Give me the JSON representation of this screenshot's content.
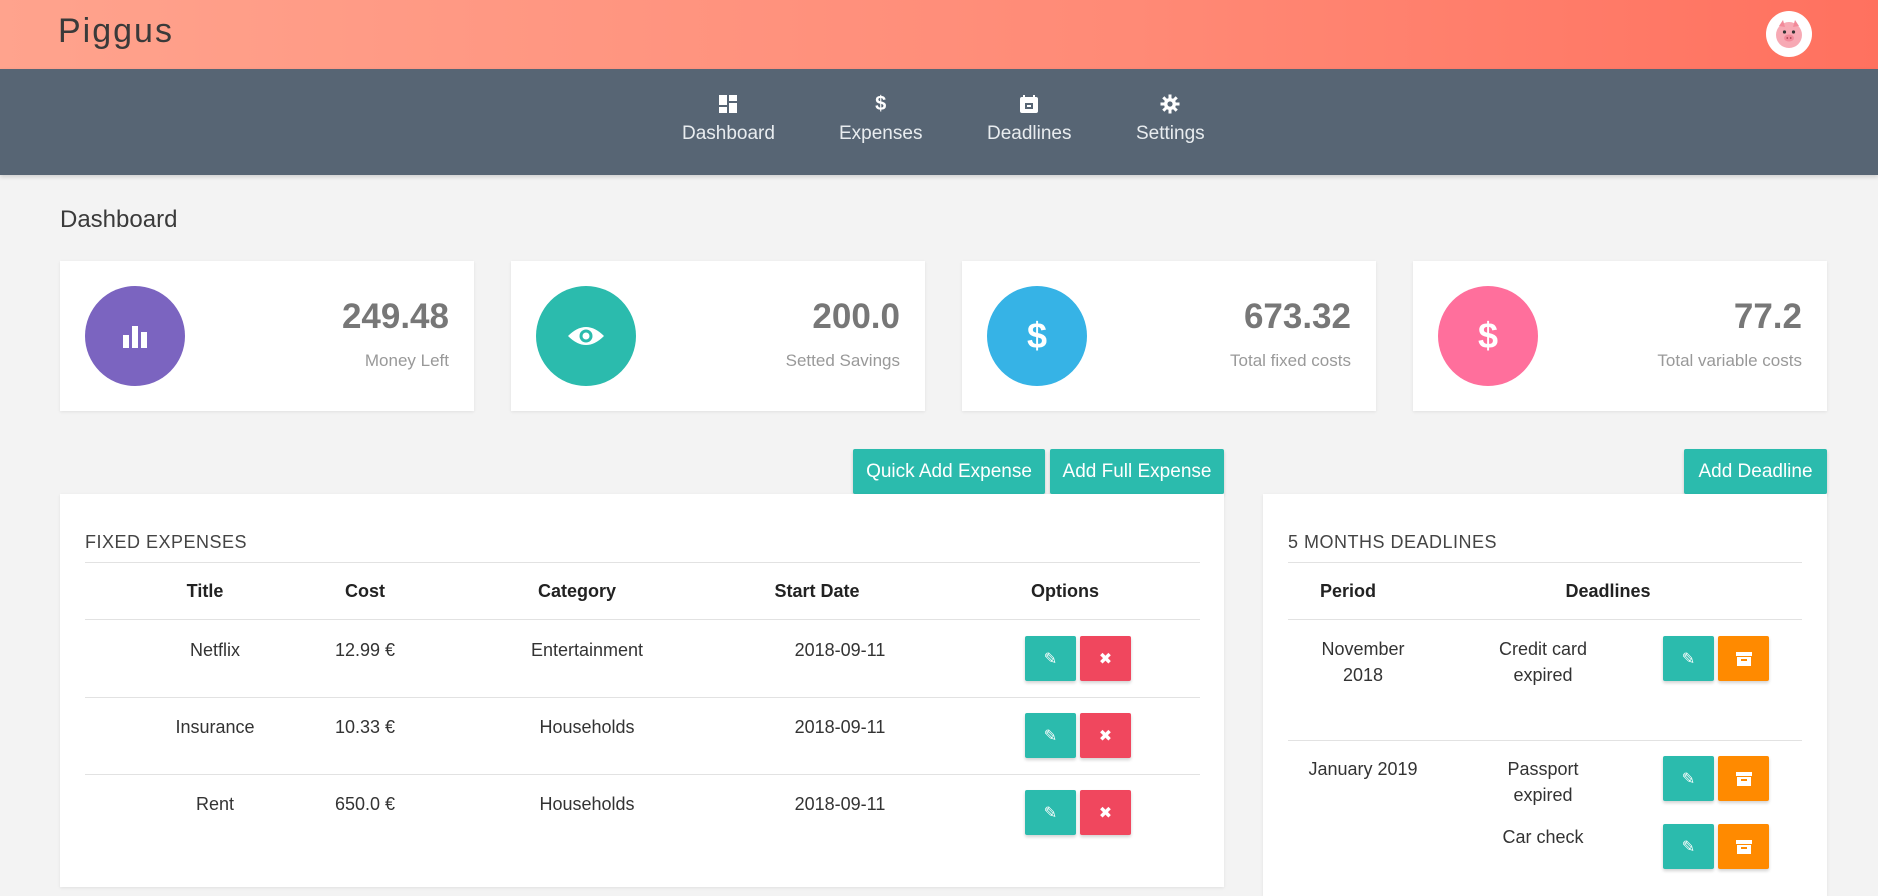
{
  "app": {
    "logo": "Piggus"
  },
  "nav": [
    {
      "label": "Dashboard",
      "icon": "dashboard-icon"
    },
    {
      "label": "Expenses",
      "icon": "dollar-icon"
    },
    {
      "label": "Deadlines",
      "icon": "calendar-icon"
    },
    {
      "label": "Settings",
      "icon": "gear-icon"
    }
  ],
  "page": {
    "title": "Dashboard"
  },
  "stats": [
    {
      "value": "249.48",
      "label": "Money Left",
      "color": "#7b64c0",
      "icon": "bar-chart-icon"
    },
    {
      "value": "200.0",
      "label": "Setted Savings",
      "color": "#2bbbad",
      "icon": "eye-icon"
    },
    {
      "value": "673.32",
      "label": "Total fixed costs",
      "color": "#36b3e6",
      "icon": "dollar-icon"
    },
    {
      "value": "77.2",
      "label": "Total variable costs",
      "color": "#ff6f9c",
      "icon": "dollar-icon"
    }
  ],
  "actions": {
    "quick_add": "Quick Add Expense",
    "full_add": "Add Full Expense",
    "add_deadline": "Add Deadline"
  },
  "fixed": {
    "title": "FIXED EXPENSES",
    "headers": [
      "Title",
      "Cost",
      "Category",
      "Start Date",
      "Options"
    ],
    "rows": [
      {
        "title": "Netflix",
        "cost": "12.99 €",
        "category": "Entertainment",
        "start": "2018-09-11"
      },
      {
        "title": "Insurance",
        "cost": "10.33 €",
        "category": "Households",
        "start": "2018-09-11"
      },
      {
        "title": "Rent",
        "cost": "650.0 €",
        "category": "Households",
        "start": "2018-09-11"
      }
    ]
  },
  "deadlines": {
    "title": "5 MONTHS DEADLINES",
    "headers": [
      "Period",
      "Deadlines"
    ],
    "groups": [
      {
        "period_line1": "November",
        "period_line2": "2018",
        "items": [
          {
            "line1": "Credit card",
            "line2": "expired"
          }
        ]
      },
      {
        "period_line1": "January 2019",
        "period_line2": "",
        "items": [
          {
            "line1": "Passport",
            "line2": "expired"
          },
          {
            "line1": "Car check",
            "line2": ""
          }
        ]
      }
    ]
  }
}
